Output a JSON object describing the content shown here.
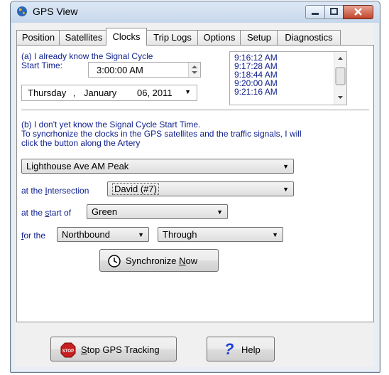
{
  "window": {
    "title": "GPS View"
  },
  "tabs": [
    "Position",
    "Satellites",
    "Clocks",
    "Trip Logs",
    "Options",
    "Setup",
    "Diagnostics"
  ],
  "active_tab": "Clocks",
  "section_a": {
    "label_line1": "(a) I already know the Signal Cycle",
    "label_line2": "Start Time:",
    "start_time": "3:00:00 AM",
    "date": {
      "day": "Thursday",
      "sep": ",",
      "month": "January",
      "daynum": "06, 2011"
    }
  },
  "times_list": [
    "9:16:12 AM",
    "9:17:28 AM",
    "9:18:44 AM",
    "9:20:00 AM",
    "9:21:16 AM"
  ],
  "section_b": {
    "line1": "(b) I don't yet know the Signal Cycle Start Time.",
    "line2": "To syncrhonize the clocks in the GPS satellites and the traffic signals, I will",
    "line3": "click the button along the Artery"
  },
  "artery": {
    "value": "Lighthouse Ave AM Peak"
  },
  "intersection": {
    "label_pre": "at the ",
    "label_ul": "I",
    "label_post": "ntersection",
    "value": "David (#7)"
  },
  "start_of": {
    "label_pre": "at the ",
    "label_ul": "s",
    "label_post": "tart of",
    "value": "Green"
  },
  "for_the": {
    "label_ul": "f",
    "label_post": "or the",
    "direction": "Northbound",
    "movement": "Through"
  },
  "sync_button": {
    "label_pre": "Synchronize ",
    "label_ul": "N",
    "label_post": "ow"
  },
  "stop_button": {
    "label_ul": "S",
    "label_post": "top GPS Tracking"
  },
  "help_button": {
    "label": "Help"
  }
}
